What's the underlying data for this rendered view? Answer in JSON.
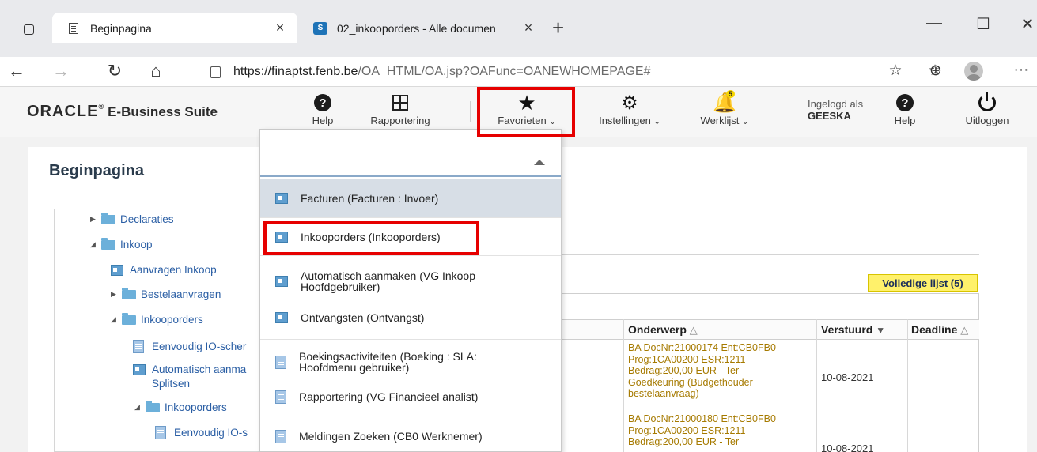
{
  "browser": {
    "tabs": [
      {
        "title": "Beginpagina",
        "close": "×"
      },
      {
        "title": "02_inkooporders - Alle documen",
        "close": "×"
      }
    ],
    "new_tab": "+",
    "window_controls": {
      "minimize": "—",
      "maximize": "☐",
      "close": "✕"
    },
    "url_host": "https://finaptst.fenb.be",
    "url_path": "/OA_HTML/OA.jsp?OAFunc=OANEWHOMEPAGE#",
    "nav": {
      "back": "←",
      "forward": "→",
      "reload": "↻",
      "home": "⌂"
    },
    "right_icons": {
      "favorite_add": "☆",
      "favorites": "☆",
      "collections": "⊕",
      "more": "···"
    }
  },
  "oracle": {
    "logo": "ORACLE",
    "logo_reg": "®",
    "suite": "E-Business Suite",
    "nav": {
      "help": "Help",
      "reporting": "Rapportering",
      "favorites": "Favorieten",
      "settings": "Instellingen",
      "worklist": "Werklijst",
      "worklist_badge": "5",
      "logged_in_label": "Ingelogd als",
      "username": "GEESKA",
      "help2": "Help",
      "logout": "Uitloggen"
    },
    "icons": [
      "help-icon",
      "reporting-icon",
      "star-icon",
      "gear-icon",
      "bell-icon",
      "help-icon",
      "power-icon"
    ]
  },
  "page": {
    "title": "Beginpagina",
    "tree": [
      {
        "label": "Declaraties",
        "type": "folder",
        "state": "collapsed"
      },
      {
        "label": "Inkoop",
        "type": "folder",
        "state": "expanded"
      },
      {
        "label": "Aanvragen Inkoop",
        "type": "function"
      },
      {
        "label": "Bestelaanvragen",
        "type": "folder",
        "state": "collapsed"
      },
      {
        "label": "Inkooporders",
        "type": "folder",
        "state": "expanded"
      },
      {
        "label": "Eenvoudig IO-scher",
        "type": "document"
      },
      {
        "label": "Automatisch aanma",
        "type": "function"
      },
      {
        "label": "Splitsen",
        "type": "text"
      },
      {
        "label": "Inkooporders",
        "type": "folder",
        "state": "expanded"
      },
      {
        "label": "Eenvoudig IO-s",
        "type": "document"
      }
    ]
  },
  "worklist": {
    "full_list_button": "Volledige lijst (5)",
    "columns": {
      "subject": "Onderwerp",
      "sent": "Verstuurd",
      "deadline": "Deadline"
    },
    "sort_asc": "△",
    "sort_desc": "▼",
    "rows": [
      {
        "subject_lines": [
          "BA DocNr:21000174 Ent:CB0FB0",
          "Prog:1CA00200 ESR:1211",
          "Bedrag:200,00 EUR - Ter",
          "Goedkeuring (Budgethouder",
          "bestelaanvraag)"
        ],
        "sent": "10-08-2021"
      },
      {
        "subject_lines": [
          "BA DocNr:21000180 Ent:CB0FB0",
          "Prog:1CA00200 ESR:1211",
          "Bedrag:200,00 EUR - Ter"
        ],
        "sent": "10-08-2021"
      }
    ]
  },
  "favorites_menu": {
    "items": [
      {
        "label": "Facturen (Facturen : Invoer)",
        "icon": "function-icon",
        "selected": true
      },
      {
        "label": "Inkooporders (Inkooporders)",
        "icon": "function-icon",
        "highlighted": true
      },
      {
        "label": "Automatisch aanmaken (VG Inkoop",
        "label2": "Hoofdgebruiker)",
        "icon": "function-icon"
      },
      {
        "label": "Ontvangsten (Ontvangst)",
        "icon": "function-icon"
      },
      {
        "label": "Boekingsactiviteiten (Boeking : SLA:",
        "label2": "Hoofdmenu gebruiker)",
        "icon": "document-icon"
      },
      {
        "label": "Rapportering (VG Financieel analist)",
        "icon": "document-icon"
      },
      {
        "label": "Meldingen Zoeken (CB0 Werknemer)",
        "icon": "document-icon"
      }
    ]
  },
  "colors": {
    "highlight": "#e60000",
    "link": "#2a5ea4",
    "worklist_text": "#a67a00",
    "button_yellow": "#fff16b"
  }
}
